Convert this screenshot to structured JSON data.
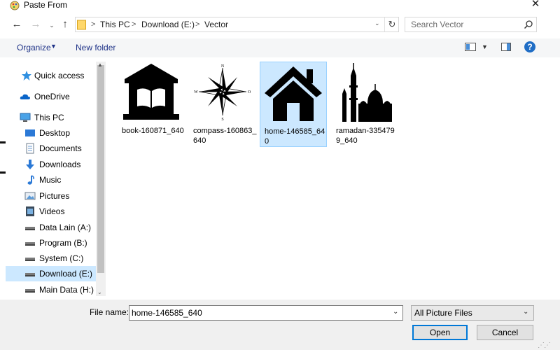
{
  "window": {
    "title": "Paste From",
    "close_glyph": "✕"
  },
  "address": {
    "crumbs": [
      "This PC",
      "Download (E:)",
      "Vector"
    ],
    "separator": ">"
  },
  "search": {
    "placeholder": "Search Vector"
  },
  "toolbar": {
    "organize_label": "Organize",
    "new_folder_label": "New folder",
    "help_label": "?"
  },
  "nav": {
    "items": [
      {
        "label": "Quick access",
        "icon": "star-icon"
      },
      {
        "label": "OneDrive",
        "icon": "cloud-icon"
      },
      {
        "label": "This PC",
        "icon": "monitor-icon"
      },
      {
        "label": "Desktop",
        "icon": "desktop-icon"
      },
      {
        "label": "Documents",
        "icon": "documents-icon"
      },
      {
        "label": "Downloads",
        "icon": "download-arrow-icon"
      },
      {
        "label": "Music",
        "icon": "music-note-icon"
      },
      {
        "label": "Pictures",
        "icon": "pictures-icon"
      },
      {
        "label": "Videos",
        "icon": "videos-icon"
      },
      {
        "label": "Data Lain (A:)",
        "icon": "drive-icon"
      },
      {
        "label": "Program (B:)",
        "icon": "drive-icon"
      },
      {
        "label": "System (C:)",
        "icon": "drive-icon"
      },
      {
        "label": "Download (E:)",
        "icon": "drive-icon",
        "selected": true
      },
      {
        "label": "Main Data (H:)",
        "icon": "drive-icon"
      }
    ]
  },
  "files": [
    {
      "name_line1": "book-160871_640",
      "name_line2": "",
      "icon": "library-building-icon"
    },
    {
      "name_line1": "compass-160863_",
      "name_line2": "640",
      "icon": "compass-rose-icon"
    },
    {
      "name_line1": "home-146585_64",
      "name_line2": "0",
      "icon": "house-icon",
      "selected": true
    },
    {
      "name_line1": "ramadan-335479",
      "name_line2": "9_640",
      "icon": "mosque-icon"
    }
  ],
  "compass_letters": {
    "n": "N",
    "s": "S",
    "e": "O",
    "w": "W"
  },
  "bottom": {
    "file_name_label": "File name:",
    "file_name_value": "home-146585_640",
    "file_type_value": "All Picture Files",
    "open_label": "Open",
    "cancel_label": "Cancel"
  },
  "colors": {
    "selection": "#cce8ff",
    "accent": "#0078d7",
    "link": "#1e3287"
  }
}
